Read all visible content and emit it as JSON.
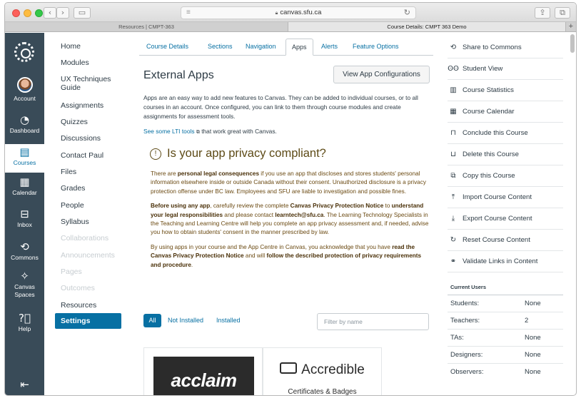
{
  "browser": {
    "url": "canvas.sfu.ca",
    "tabs": [
      "Resources | CMPT-363",
      "Course Details: CMPT 363 Demo"
    ]
  },
  "global_nav": [
    {
      "label": "Account",
      "icon": "avatar"
    },
    {
      "label": "Dashboard",
      "icon": "dashboard-icon"
    },
    {
      "label": "Courses",
      "icon": "book-icon"
    },
    {
      "label": "Calendar",
      "icon": "calendar-icon"
    },
    {
      "label": "Inbox",
      "icon": "inbox-icon"
    },
    {
      "label": "Commons",
      "icon": "commons-icon"
    },
    {
      "label": "Canvas Spaces",
      "icon": "spaces-icon"
    },
    {
      "label": "Help",
      "icon": "help-icon"
    }
  ],
  "course_nav": [
    {
      "label": "Home"
    },
    {
      "label": "Modules"
    },
    {
      "label": "UX Techniques Guide"
    },
    {
      "label": "Assignments"
    },
    {
      "label": "Quizzes"
    },
    {
      "label": "Discussions"
    },
    {
      "label": "Contact Paul"
    },
    {
      "label": "Files"
    },
    {
      "label": "Grades"
    },
    {
      "label": "People"
    },
    {
      "label": "Syllabus"
    },
    {
      "label": "Collaborations"
    },
    {
      "label": "Announcements"
    },
    {
      "label": "Pages"
    },
    {
      "label": "Outcomes"
    },
    {
      "label": "Resources"
    },
    {
      "label": "Settings"
    }
  ],
  "subtabs": [
    "Course Details",
    "Sections",
    "Navigation",
    "Apps",
    "Alerts",
    "Feature Options"
  ],
  "main": {
    "title": "External Apps",
    "view_button": "View App Configurations",
    "intro": "Apps are an easy way to add new features to Canvas. They can be added to individual courses, or to all courses in an account. Once configured, you can link to them through course modules and create assignments for assessment tools.",
    "lti_link": "See some LTI tools",
    "lti_suffix": "that work great with Canvas.",
    "privacy_title": "Is your app privacy compliant?",
    "p1": {
      "a": "There are ",
      "b": "personal legal consequences",
      "c": " if you use an app that discloses and stores students' personal information elsewhere inside or outside Canada without their consent. Unauthorized disclosure is a privacy protection offense under BC law. Employees and SFU are liable to investigation and possible fines."
    },
    "p2": {
      "a": "Before using any app",
      "b": ", carefully review the complete ",
      "c": "Canvas Privacy Protection Notice",
      "d": " to ",
      "e": "understand your legal responsibilities",
      "f": " and please contact ",
      "g": "learntech@sfu.ca",
      "h": ". The Learning Technology Specialists in the Teaching and Learning Centre will help you complete an app privacy assessment and, if needed, advise you how to obtain students' consent in the manner prescribed by law."
    },
    "p3": {
      "a": "By using apps in your course and the App Centre in Canvas, you acknowledge that you have ",
      "b": "read the Canvas Privacy Protection Notice",
      "c": " and will ",
      "d": "follow the described protection of privacy requirements and procedure",
      "e": "."
    },
    "filters": [
      "All",
      "Not Installed",
      "Installed"
    ],
    "filter_placeholder": "Filter by name",
    "cards": [
      {
        "name": "acclaim"
      },
      {
        "name": "Accredible",
        "subtitle": "Certificates & Badges"
      }
    ]
  },
  "right_sidebar": [
    {
      "label": "Share to Commons",
      "icon": "commons-icon"
    },
    {
      "label": "Student View",
      "icon": "glasses-icon"
    },
    {
      "label": "Course Statistics",
      "icon": "statistics-icon"
    },
    {
      "label": "Course Calendar",
      "icon": "calendar-icon"
    },
    {
      "label": "Conclude this Course",
      "icon": "lock-icon"
    },
    {
      "label": "Delete this Course",
      "icon": "trash-icon"
    },
    {
      "label": "Copy this Course",
      "icon": "copy-icon"
    },
    {
      "label": "Import Course Content",
      "icon": "import-icon"
    },
    {
      "label": "Export Course Content",
      "icon": "export-icon"
    },
    {
      "label": "Reset Course Content",
      "icon": "reset-icon"
    },
    {
      "label": "Validate Links in Content",
      "icon": "link-icon"
    }
  ],
  "current_users": {
    "title": "Current Users",
    "rows": [
      {
        "role": "Students:",
        "value": "None"
      },
      {
        "role": "Teachers:",
        "value": "2"
      },
      {
        "role": "TAs:",
        "value": "None"
      },
      {
        "role": "Designers:",
        "value": "None"
      },
      {
        "role": "Observers:",
        "value": "None"
      }
    ]
  }
}
